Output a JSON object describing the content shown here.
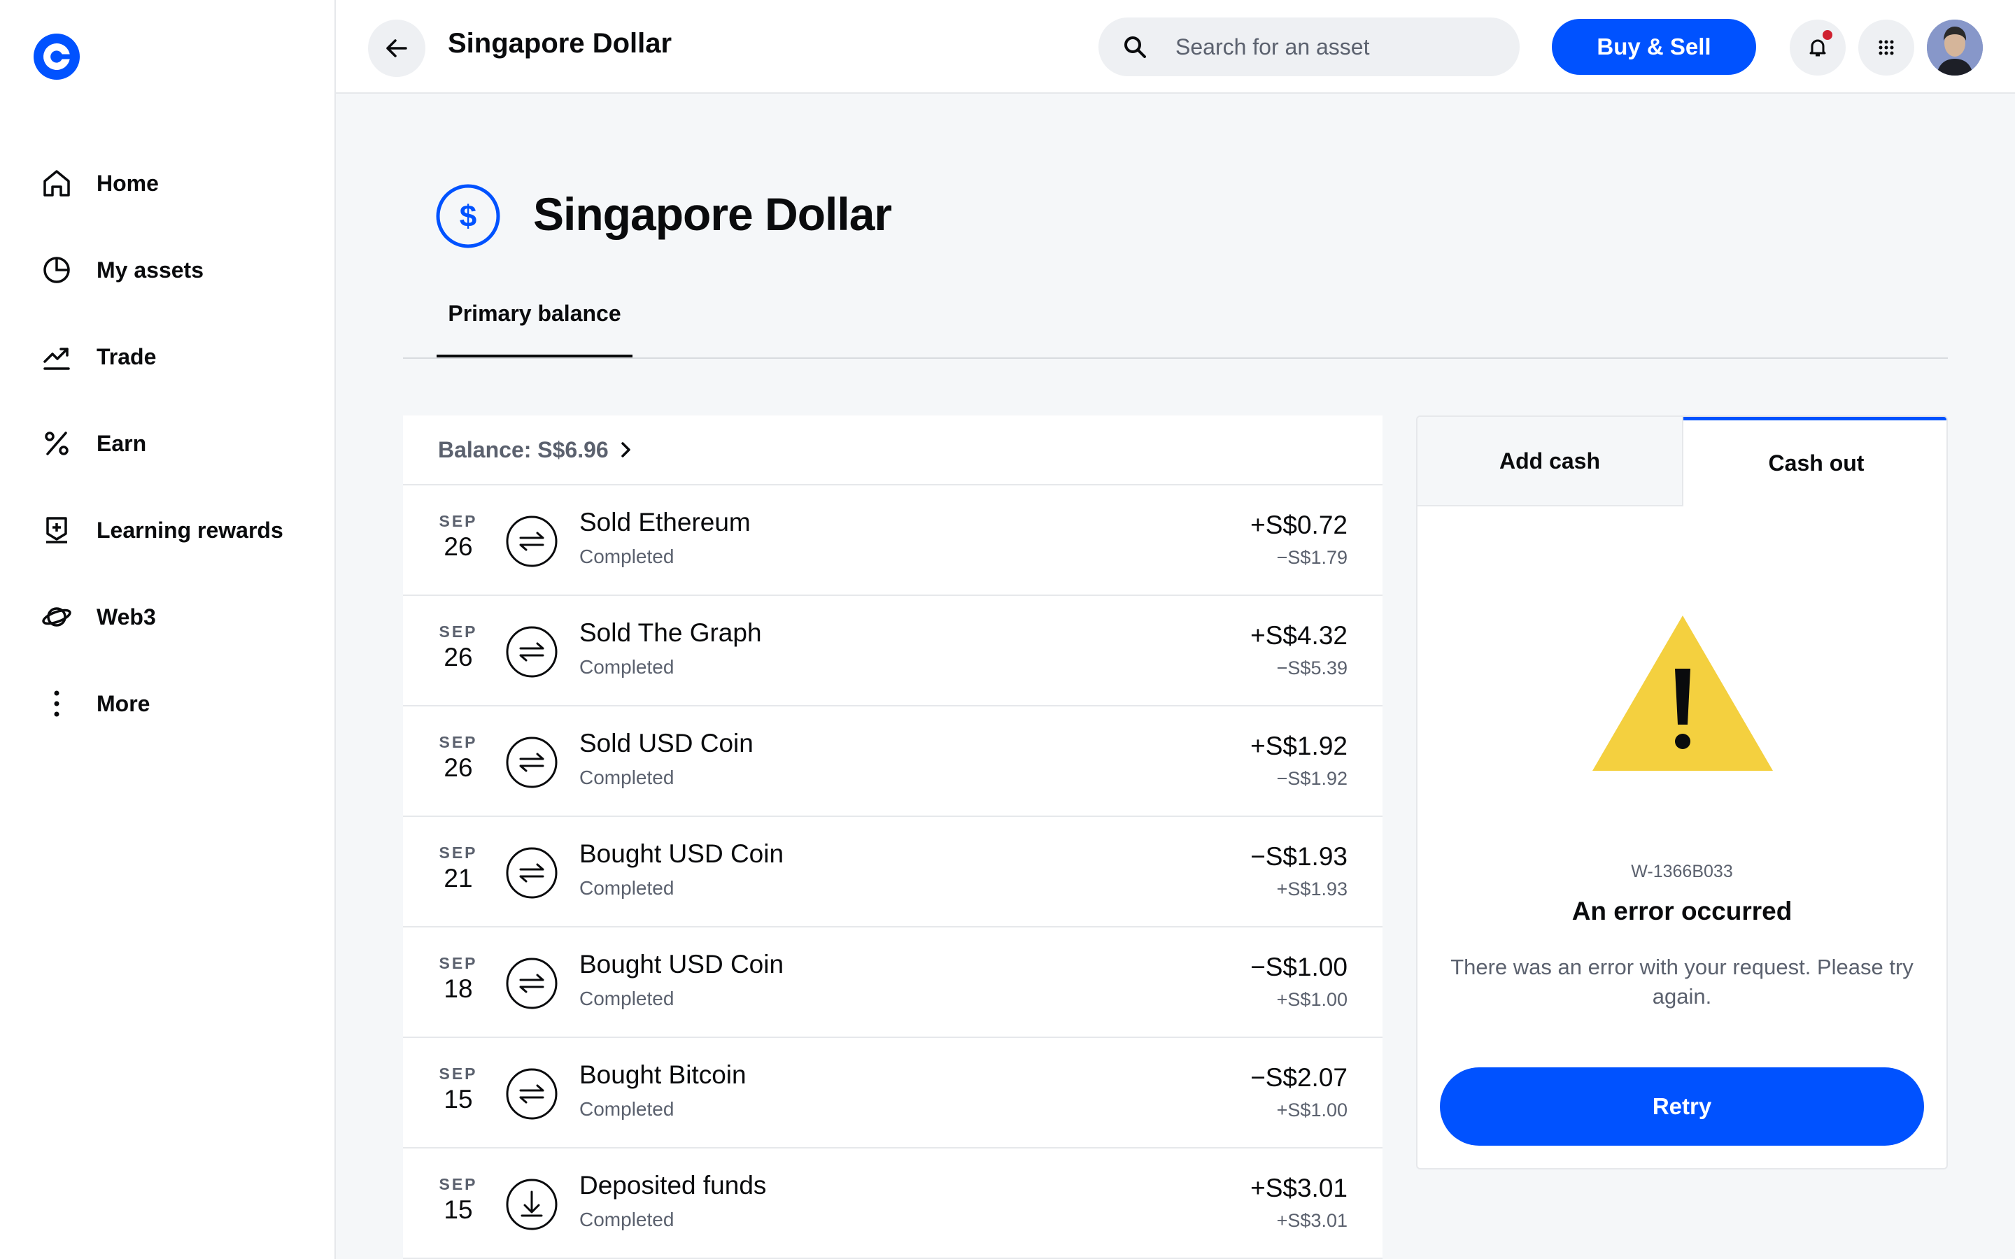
{
  "brand": {
    "accent": "#0052ff",
    "logo": "coinbase-logo"
  },
  "sidebar": {
    "items": [
      {
        "label": "Home",
        "icon": "home-icon"
      },
      {
        "label": "My assets",
        "icon": "pie-chart-icon"
      },
      {
        "label": "Trade",
        "icon": "trending-up-icon"
      },
      {
        "label": "Earn",
        "icon": "percent-icon"
      },
      {
        "label": "Learning rewards",
        "icon": "rewards-icon"
      },
      {
        "label": "Web3",
        "icon": "planet-icon"
      },
      {
        "label": "More",
        "icon": "more-vertical-icon"
      }
    ]
  },
  "header": {
    "title": "Singapore Dollar",
    "search_placeholder": "Search for an asset",
    "buy_sell_label": "Buy & Sell"
  },
  "main": {
    "title": "Singapore Dollar",
    "tab": "Primary balance",
    "balance_label": "Balance: S$6.96"
  },
  "transactions": [
    {
      "month": "SEP",
      "day": "26",
      "name": "Sold Ethereum",
      "status": "Completed",
      "amount": "+S$0.72",
      "sub": "−S$1.79",
      "icon": "swap-icon"
    },
    {
      "month": "SEP",
      "day": "26",
      "name": "Sold The Graph",
      "status": "Completed",
      "amount": "+S$4.32",
      "sub": "−S$5.39",
      "icon": "swap-icon"
    },
    {
      "month": "SEP",
      "day": "26",
      "name": "Sold USD Coin",
      "status": "Completed",
      "amount": "+S$1.92",
      "sub": "−S$1.92",
      "icon": "swap-icon"
    },
    {
      "month": "SEP",
      "day": "21",
      "name": "Bought USD Coin",
      "status": "Completed",
      "amount": "−S$1.93",
      "sub": "+S$1.93",
      "icon": "swap-icon"
    },
    {
      "month": "SEP",
      "day": "18",
      "name": "Bought USD Coin",
      "status": "Completed",
      "amount": "−S$1.00",
      "sub": "+S$1.00",
      "icon": "swap-icon"
    },
    {
      "month": "SEP",
      "day": "15",
      "name": "Bought Bitcoin",
      "status": "Completed",
      "amount": "−S$2.07",
      "sub": "+S$1.00",
      "icon": "swap-icon"
    },
    {
      "month": "SEP",
      "day": "15",
      "name": "Deposited funds",
      "status": "Completed",
      "amount": "+S$3.01",
      "sub": "+S$3.01",
      "icon": "deposit-icon"
    }
  ],
  "card": {
    "tab_add": "Add cash",
    "tab_cash_out": "Cash out",
    "error_code": "W-1366B033",
    "error_title": "An error occurred",
    "error_description": "There was an error with your request. Please try again.",
    "retry_label": "Retry",
    "warning_color": "#f4d03f"
  }
}
